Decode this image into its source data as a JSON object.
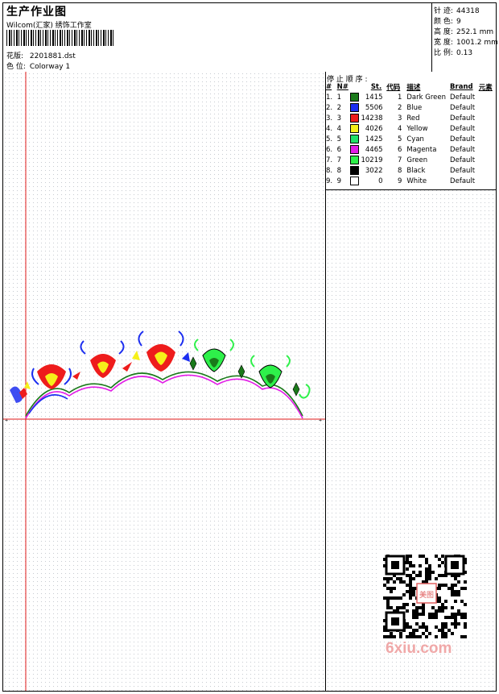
{
  "header": {
    "title": "生产作业图",
    "studio": "Wilcom(汇家) 绣饰工作室",
    "design_label": "花版:",
    "design_value": "2201881.dst",
    "colorway_label": "色 位:",
    "colorway_value": "Colorway 1"
  },
  "stats": [
    {
      "label": "针 迹:",
      "value": "44318"
    },
    {
      "label": "颜 色:",
      "value": "9"
    },
    {
      "label": "高 度:",
      "value": "252.1 mm"
    },
    {
      "label": "宽 度:",
      "value": "1001.2 mm"
    },
    {
      "label": "比 例:",
      "value": "0.13"
    }
  ],
  "stop_sequence": {
    "title": "停 止 顺 序 :",
    "headers": [
      "#",
      "N#",
      "St.",
      "代码",
      "描述",
      "Brand",
      "元素"
    ],
    "rows": [
      {
        "idx": "1.",
        "n": "1",
        "color": "#1a7a1a",
        "st": "1415",
        "code": "1",
        "desc": "Dark Green",
        "brand": "Default"
      },
      {
        "idx": "2.",
        "n": "2",
        "color": "#1c2ef0",
        "st": "5506",
        "code": "2",
        "desc": "Blue",
        "brand": "Default"
      },
      {
        "idx": "3.",
        "n": "3",
        "color": "#ee1c1c",
        "st": "14238",
        "code": "3",
        "desc": "Red",
        "brand": "Default"
      },
      {
        "idx": "4.",
        "n": "4",
        "color": "#f6f01a",
        "st": "4026",
        "code": "4",
        "desc": "Yellow",
        "brand": "Default"
      },
      {
        "idx": "5.",
        "n": "5",
        "color": "#22e068",
        "st": "1425",
        "code": "5",
        "desc": "Cyan",
        "brand": "Default"
      },
      {
        "idx": "6.",
        "n": "6",
        "color": "#e21ce6",
        "st": "4465",
        "code": "6",
        "desc": "Magenta",
        "brand": "Default"
      },
      {
        "idx": "7.",
        "n": "7",
        "color": "#2ef04a",
        "st": "10219",
        "code": "7",
        "desc": "Green",
        "brand": "Default"
      },
      {
        "idx": "8.",
        "n": "8",
        "color": "#000000",
        "st": "3022",
        "code": "8",
        "desc": "Black",
        "brand": "Default"
      },
      {
        "idx": "9.",
        "n": "9",
        "color": "#ffffff",
        "st": "0",
        "code": "9",
        "desc": "White",
        "brand": "Default"
      }
    ]
  },
  "watermark": {
    "stamp": "美图",
    "brand": "6xiu.com"
  },
  "colors": {
    "guide": "#e01818",
    "watermark": "#f0a8a8"
  }
}
